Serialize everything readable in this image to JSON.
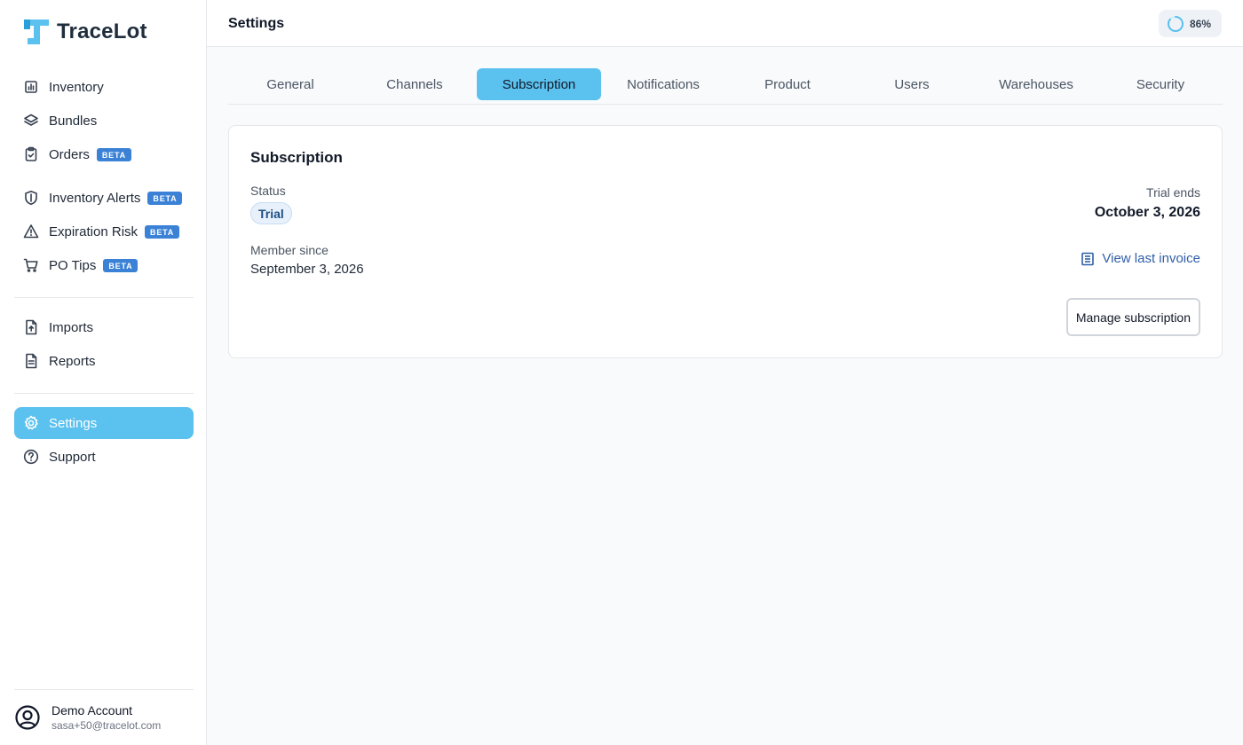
{
  "app": {
    "name": "TraceLot",
    "brand_color": "#5bc1ee"
  },
  "sidebar": {
    "groups": [
      [
        {
          "label": "Inventory",
          "icon": "chart-bar-icon",
          "badge": null
        },
        {
          "label": "Bundles",
          "icon": "layers-icon",
          "badge": null
        },
        {
          "label": "Orders",
          "icon": "clipboard-check-icon",
          "badge": "BETA"
        }
      ],
      [
        {
          "label": "Inventory Alerts",
          "icon": "shield-icon",
          "badge": "BETA"
        },
        {
          "label": "Expiration Risk",
          "icon": "warning-icon",
          "badge": "BETA"
        },
        {
          "label": "PO Tips",
          "icon": "cart-icon",
          "badge": "BETA"
        }
      ],
      [
        {
          "label": "Imports",
          "icon": "file-upload-icon",
          "badge": null
        },
        {
          "label": "Reports",
          "icon": "file-text-icon",
          "badge": null
        }
      ],
      [
        {
          "label": "Settings",
          "icon": "gear-icon",
          "badge": null,
          "active": true
        },
        {
          "label": "Support",
          "icon": "help-circle-icon",
          "badge": null
        }
      ]
    ],
    "account": {
      "name": "Demo Account",
      "email": "sasa+50@tracelot.com"
    }
  },
  "header": {
    "title": "Settings",
    "progress": "86%",
    "progress_value": 0.86
  },
  "tabs": [
    {
      "label": "General"
    },
    {
      "label": "Channels"
    },
    {
      "label": "Subscription",
      "active": true
    },
    {
      "label": "Notifications"
    },
    {
      "label": "Product"
    },
    {
      "label": "Users"
    },
    {
      "label": "Warehouses"
    },
    {
      "label": "Security"
    }
  ],
  "subscription": {
    "title": "Subscription",
    "status_label": "Status",
    "status_value": "Trial",
    "member_since_label": "Member since",
    "member_since_value": "September 3, 2026",
    "trial_ends_label": "Trial ends",
    "trial_ends_value": "October 3, 2026",
    "invoice_link": "View last invoice",
    "manage_button": "Manage subscription"
  }
}
